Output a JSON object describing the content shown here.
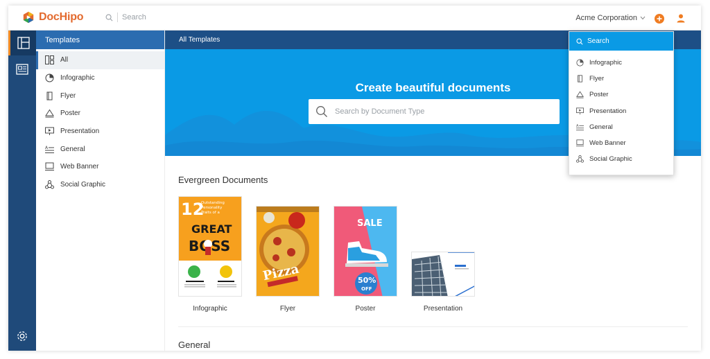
{
  "topbar": {
    "brand": "DocHipo",
    "search_placeholder": "Search",
    "account": "Acme Corporation"
  },
  "sidebar": {
    "header": "Templates",
    "items": [
      {
        "label": "All",
        "icon": "grid-icon"
      },
      {
        "label": "Infographic",
        "icon": "pie-chart-icon"
      },
      {
        "label": "Flyer",
        "icon": "flyer-icon"
      },
      {
        "label": "Poster",
        "icon": "triangle-icon"
      },
      {
        "label": "Presentation",
        "icon": "presentation-icon"
      },
      {
        "label": "General",
        "icon": "text-lines-icon"
      },
      {
        "label": "Web Banner",
        "icon": "monitor-icon"
      },
      {
        "label": "Social Graphic",
        "icon": "share-icon"
      }
    ]
  },
  "main": {
    "header": "All Templates",
    "hero_title": "Create beautiful documents",
    "hero_search_placeholder": "Search by Document Type",
    "section1": "Evergreen Documents",
    "cards": [
      {
        "label": "Infographic",
        "thumb_text_1": "12",
        "thumb_text_2": "Outstanding Personality Traits of a",
        "thumb_text_3": "GREAT",
        "thumb_text_4": "BOSS"
      },
      {
        "label": "Flyer",
        "thumb_text_1": "Pizza"
      },
      {
        "label": "Poster",
        "thumb_text_1": "SALE",
        "thumb_text_2": "50%",
        "thumb_text_3": "OFF"
      },
      {
        "label": "Presentation"
      }
    ],
    "section2": "General"
  },
  "dropdown": {
    "search_label": "Search",
    "items": [
      {
        "label": "Infographic",
        "icon": "pie-chart-icon"
      },
      {
        "label": "Flyer",
        "icon": "flyer-icon"
      },
      {
        "label": "Poster",
        "icon": "triangle-icon"
      },
      {
        "label": "Presentation",
        "icon": "presentation-icon"
      },
      {
        "label": "General",
        "icon": "text-lines-icon"
      },
      {
        "label": "Web Banner",
        "icon": "monitor-icon"
      },
      {
        "label": "Social Graphic",
        "icon": "share-icon"
      }
    ]
  },
  "colors": {
    "brand_orange": "#e36a2e",
    "brand_blue": "#2b6cb0",
    "rail": "#1f4a7a",
    "hero": "#0a9ae5"
  }
}
